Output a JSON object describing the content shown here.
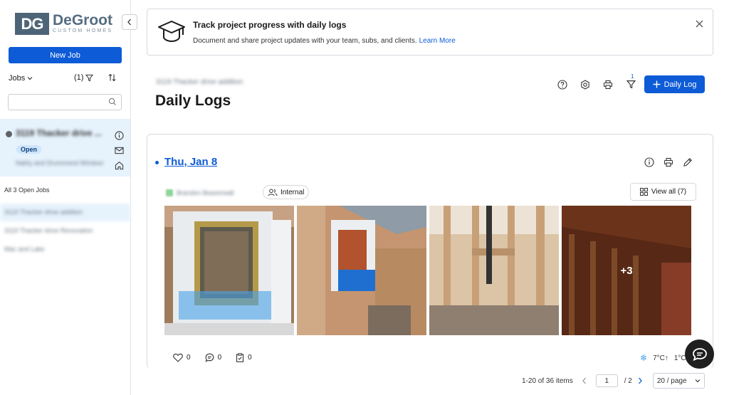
{
  "brand": {
    "mark": "DG",
    "name": "DeGroot",
    "sub": "CUSTOM HOMES"
  },
  "sidebar": {
    "new_job_label": "New Job",
    "jobs_label": "Jobs",
    "filter_count": "(1)",
    "search_placeholder": "",
    "job_card": {
      "title": "3119 Thacker drive ...",
      "status": "Open",
      "subtitle": "Nathy and Drummond Windsor"
    },
    "open_jobs_label": "All 3 Open Jobs",
    "jobs": [
      "3119 Thacker drive addition",
      "3119 Thacker drive Renovation",
      "Mac and Lake"
    ]
  },
  "banner": {
    "title": "Track project progress with daily logs",
    "text": "Document and share project updates with your team, subs, and clients.",
    "link": "Learn More"
  },
  "header": {
    "breadcrumb": "3119 Thacker drive addition",
    "title": "Daily Logs",
    "filter_badge": "1",
    "add_button": "Daily Log"
  },
  "log": {
    "date": "Thu, Jan 8",
    "author": "Brandon Beaverwall",
    "visibility": "Internal",
    "view_all": "View all (7)",
    "more_photos": "+3",
    "likes": "0",
    "comments": "0",
    "tasks": "0",
    "weather_temp": "7°C↑",
    "weather_low": "1°C"
  },
  "pagination": {
    "range": "1-20 of 36 items",
    "current_page": "1",
    "total": "/ 2",
    "page_size": "20 / page"
  },
  "colors": {
    "primary": "#0d5bd7",
    "selected_bg": "#e6f2fc"
  }
}
